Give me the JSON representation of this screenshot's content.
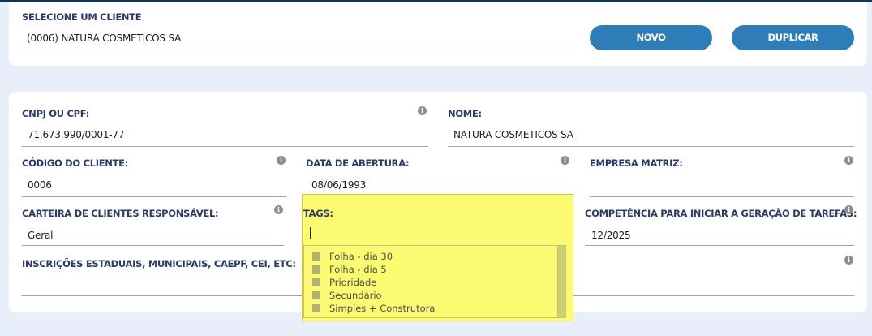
{
  "client_select": {
    "label": "SELECIONE UM CLIENTE",
    "value": "(0006) NATURA COSMETICOS SA",
    "new_button": "NOVO",
    "duplicate_button": "DUPLICAR"
  },
  "form": {
    "cnpj": {
      "label": "CNPJ OU CPF:",
      "value": "71.673.990/0001-77"
    },
    "nome": {
      "label": "NOME:",
      "value": "NATURA COSMETICOS SA"
    },
    "codigo": {
      "label": "CÓDIGO DO CLIENTE:",
      "value": "0006"
    },
    "data_abertura": {
      "label": "DATA DE ABERTURA:",
      "value": "08/06/1993"
    },
    "empresa_matriz": {
      "label": "EMPRESA MATRIZ:",
      "value": ""
    },
    "carteira": {
      "label": "CARTEIRA DE CLIENTES RESPONSÁVEL:",
      "value": "Geral"
    },
    "tags": {
      "label": "TAGS:",
      "value": "",
      "options": [
        "Folha - dia 30",
        "Folha - dia 5",
        "Prioridade",
        "Secundário",
        "Simples + Construtora"
      ]
    },
    "competencia": {
      "label": "COMPETÊNCIA PARA INICIAR A GERAÇÃO DE TAREFAS:",
      "value": "12/2025"
    },
    "inscricoes": {
      "label": "INSCRIÇÕES ESTADUAIS, MUNICIPAIS, CAEPF, CEI, ETC:",
      "value": ""
    }
  },
  "icons": {
    "info": "info-icon",
    "checkbox": "checkbox-icon"
  },
  "colors": {
    "primary_button": "#2f7db8",
    "highlight": "#fbfb72",
    "label": "#2a3a6b",
    "top_bar": "#0e3358"
  }
}
